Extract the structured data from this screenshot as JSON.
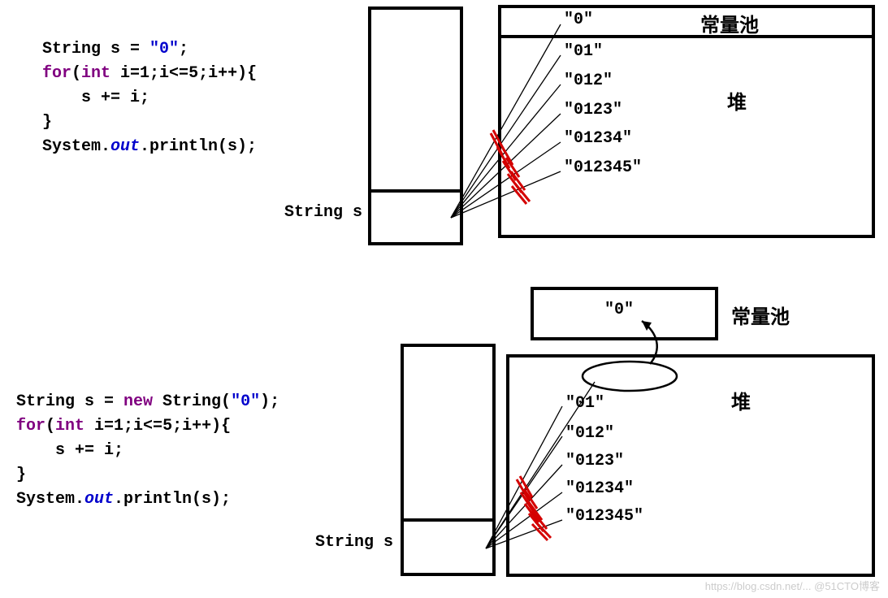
{
  "code1": {
    "l1a": "String s = ",
    "l1b": "\"0\"",
    "l1c": ";",
    "l2a": "for",
    "l2b": "(",
    "l2c": "int",
    "l2d": " i=1;i<=5;i++){",
    "l3": "    s += i;",
    "l4": "}",
    "l5a": "System.",
    "l5b": "out",
    "l5c": ".println(s);"
  },
  "code2": {
    "l1a": "String s = ",
    "l1b": "new",
    "l1c": " String(",
    "l1d": "\"0\"",
    "l1e": ");",
    "l2a": "for",
    "l2b": "(",
    "l2c": "int",
    "l2d": " i=1;i<=5;i++){",
    "l3": "    s += i;",
    "l4": "}",
    "l5a": "System.",
    "l5b": "out",
    "l5c": ".println(s);"
  },
  "labels": {
    "string_s_1": "String s",
    "string_s_2": "String s",
    "pool_1": "常量池",
    "pool_2": "常量池",
    "heap_1": "堆",
    "heap_2": "堆",
    "zero_pool": "\"0\""
  },
  "heap1": [
    "\"0\"",
    "\"01\"",
    "\"012\"",
    "\"0123\"",
    "\"01234\"",
    "\"012345\""
  ],
  "heap2": [
    "\"01\"",
    "\"012\"",
    "\"0123\"",
    "\"01234\"",
    "\"012345\""
  ],
  "watermark": "https://blog.csdn.net/... @51CTO博客"
}
